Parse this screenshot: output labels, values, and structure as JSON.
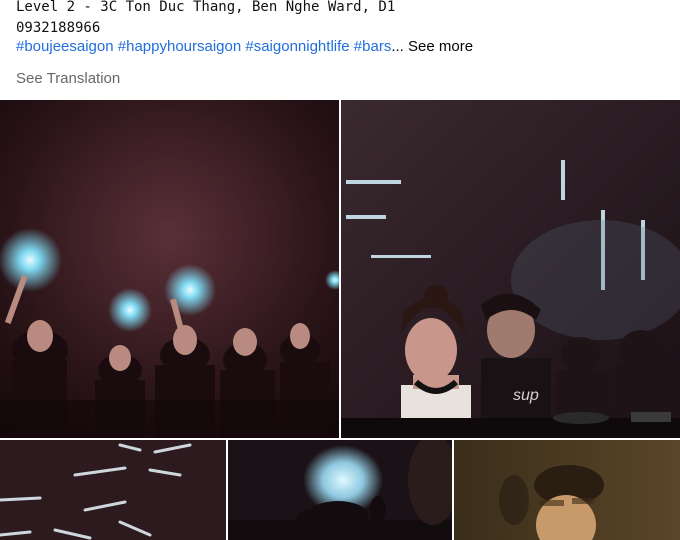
{
  "post": {
    "address_line": "Level 2 - 3C Ton Duc Thang, Ben Nghe Ward, D1",
    "phone_line": "0932188966",
    "hashtags": [
      "#boujeesaigon",
      "#happyhoursaigon",
      "#saigonnightlife",
      "#bars"
    ],
    "ellipsis": "...",
    "see_more_label": "See more",
    "see_translation_label": "See Translation"
  },
  "photos": [
    {
      "icon": "photo-party-crowd"
    },
    {
      "icon": "photo-dj-set"
    },
    {
      "icon": "photo-ceiling-lights"
    },
    {
      "icon": "photo-club-silhouettes"
    },
    {
      "icon": "photo-guest-portrait"
    }
  ],
  "colors": {
    "hashtag": "#216fdb",
    "secondary_text": "#65676b",
    "primary_text": "#050505"
  }
}
